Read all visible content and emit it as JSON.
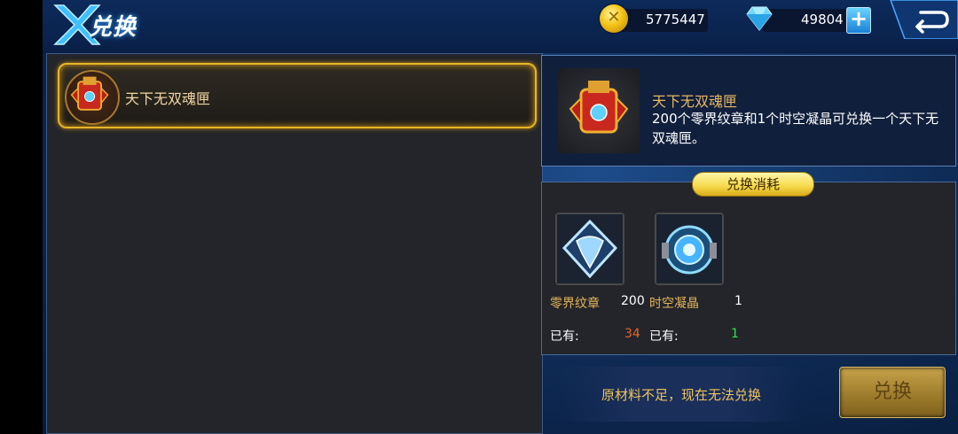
{
  "header": {
    "title": "兑换",
    "gold": "5775447",
    "gems": "49804"
  },
  "list": {
    "items": [
      {
        "name": "天下无双魂匣",
        "selected": true
      }
    ]
  },
  "detail": {
    "name": "天下无双魂匣",
    "description": "200个零界纹章和1个时空凝晶可兑换一个天下无双魂匣。"
  },
  "cost": {
    "tag": "兑换消耗",
    "materials": [
      {
        "name": "零界纹章",
        "required": "200",
        "owned_label": "已有:",
        "owned": "34",
        "sufficient": false
      },
      {
        "name": "时空凝晶",
        "required": "1",
        "owned_label": "已有:",
        "owned": "1",
        "sufficient": true
      }
    ]
  },
  "footer": {
    "warning": "原材料不足，现在无法兑换",
    "exchange_label": "兑换"
  },
  "colors": {
    "accent_gold": "#e6b52a",
    "insufficient": "#e8622a",
    "sufficient": "#3ae04a"
  }
}
